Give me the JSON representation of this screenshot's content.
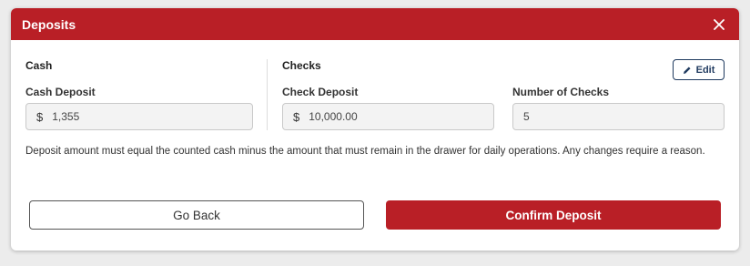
{
  "dialog": {
    "title": "Deposits",
    "close_icon": "close-icon"
  },
  "cash": {
    "section_label": "Cash",
    "deposit_label": "Cash Deposit",
    "currency_symbol": "$",
    "deposit_value": "1,355"
  },
  "checks": {
    "section_label": "Checks",
    "edit_label": "Edit",
    "edit_icon": "pencil-icon",
    "deposit_label": "Check Deposit",
    "currency_symbol": "$",
    "deposit_value": "10,000.00",
    "count_label": "Number of Checks",
    "count_value": "5"
  },
  "note": "Deposit amount must equal the counted cash minus the amount that must remain in the drawer for daily operations. Any changes require a reason.",
  "actions": {
    "back_label": "Go Back",
    "confirm_label": "Confirm Deposit"
  },
  "colors": {
    "brand_red": "#b91f26",
    "edit_navy": "#1f3a5f"
  }
}
